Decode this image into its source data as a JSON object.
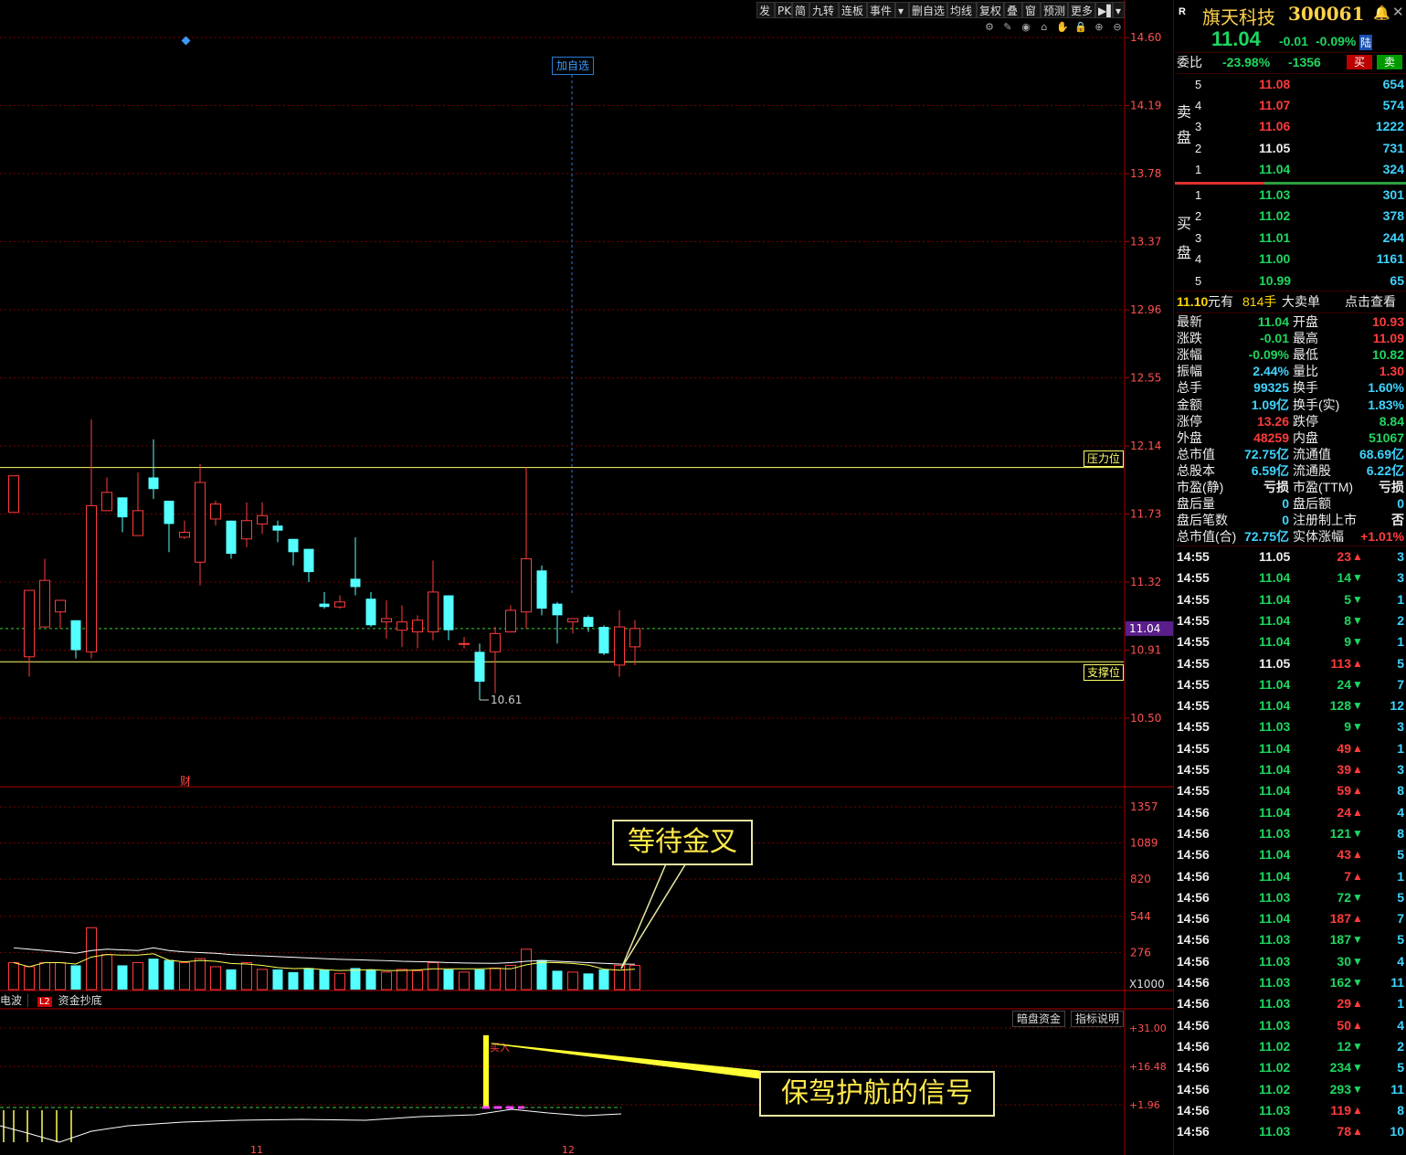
{
  "toolbar": {
    "buttons": [
      "发",
      "PK",
      "简",
      "九转",
      "连板",
      "事件",
      "▾",
      "删自选",
      "均线",
      "复权",
      "叠",
      "窗",
      "预测",
      "更多",
      "▶▌",
      "▾"
    ],
    "icons": [
      "gear-icon",
      "pen-icon",
      "eye-icon",
      "lock-open-icon",
      "hand-icon",
      "lock-icon",
      "zoom-in-icon",
      "zoom-out-icon"
    ]
  },
  "price_axis": [
    "14.60",
    "14.19",
    "13.78",
    "13.37",
    "12.96",
    "12.55",
    "12.14",
    "11.73",
    "11.32",
    "11.04",
    "10.91",
    "10.50"
  ],
  "volume_axis": [
    "1357",
    "1089",
    "820",
    "544",
    "276",
    "X1000"
  ],
  "indicator_axis": [
    "+31.00",
    "+16.48",
    "+1.96"
  ],
  "date_axis": [
    "11",
    "12"
  ],
  "labels": {
    "add_watch": "加自选",
    "resistance": "压力位",
    "support": "支撑位",
    "low_mark": "10.61",
    "finance": "财",
    "indicator_tab_left": "电波",
    "indicator_tab_l2": "L2",
    "indicator_tab_name": "资金抄底",
    "dark_fund_btn": "暗盘资金",
    "indicator_help_btn": "指标说明",
    "buy_signal": "买入"
  },
  "callouts": {
    "golden_cross": "等待金叉",
    "escort_signal": "保驾护航的信号"
  },
  "chart_data": {
    "type": "candlestick",
    "price_range": [
      10.3,
      14.7
    ],
    "resistance_level": 12.01,
    "support_level": 10.84,
    "last_price_line": 11.04,
    "low_annotation": 10.61,
    "candles": [
      {
        "o": 11.74,
        "c": 11.96,
        "h": 11.96,
        "l": 11.74
      },
      {
        "o": 10.87,
        "c": 11.27,
        "h": 11.27,
        "l": 10.75
      },
      {
        "o": 11.05,
        "c": 11.33,
        "h": 11.46,
        "l": 11.05
      },
      {
        "o": 11.14,
        "c": 11.21,
        "h": 11.21,
        "l": 11.04
      },
      {
        "o": 11.09,
        "c": 10.91,
        "h": 11.09,
        "l": 10.86
      },
      {
        "o": 10.9,
        "c": 11.78,
        "h": 12.3,
        "l": 10.86
      },
      {
        "o": 11.75,
        "c": 11.86,
        "h": 11.95,
        "l": 11.75
      },
      {
        "o": 11.83,
        "c": 11.71,
        "h": 11.83,
        "l": 11.62
      },
      {
        "o": 11.6,
        "c": 11.75,
        "h": 11.98,
        "l": 11.6
      },
      {
        "o": 11.95,
        "c": 11.88,
        "h": 12.18,
        "l": 11.82
      },
      {
        "o": 11.81,
        "c": 11.67,
        "h": 11.81,
        "l": 11.5
      },
      {
        "o": 11.59,
        "c": 11.62,
        "h": 11.69,
        "l": 11.58
      },
      {
        "o": 11.44,
        "c": 11.92,
        "h": 12.03,
        "l": 11.3
      },
      {
        "o": 11.7,
        "c": 11.79,
        "h": 11.81,
        "l": 11.66
      },
      {
        "o": 11.69,
        "c": 11.49,
        "h": 11.69,
        "l": 11.46
      },
      {
        "o": 11.58,
        "c": 11.69,
        "h": 11.8,
        "l": 11.53
      },
      {
        "o": 11.67,
        "c": 11.72,
        "h": 11.8,
        "l": 11.61
      },
      {
        "o": 11.66,
        "c": 11.63,
        "h": 11.69,
        "l": 11.56
      },
      {
        "o": 11.58,
        "c": 11.5,
        "h": 11.58,
        "l": 11.42
      },
      {
        "o": 11.52,
        "c": 11.38,
        "h": 11.52,
        "l": 11.32
      },
      {
        "o": 11.19,
        "c": 11.17,
        "h": 11.26,
        "l": 11.16
      },
      {
        "o": 11.17,
        "c": 11.2,
        "h": 11.24,
        "l": 11.16
      },
      {
        "o": 11.34,
        "c": 11.29,
        "h": 11.59,
        "l": 11.24
      },
      {
        "o": 11.22,
        "c": 11.06,
        "h": 11.26,
        "l": 11.05
      },
      {
        "o": 11.08,
        "c": 11.1,
        "h": 11.21,
        "l": 10.98
      },
      {
        "o": 11.03,
        "c": 11.08,
        "h": 11.18,
        "l": 10.93
      },
      {
        "o": 11.02,
        "c": 11.09,
        "h": 11.12,
        "l": 10.92
      },
      {
        "o": 11.02,
        "c": 11.26,
        "h": 11.45,
        "l": 10.97
      },
      {
        "o": 11.24,
        "c": 11.03,
        "h": 11.24,
        "l": 10.97
      },
      {
        "o": 10.95,
        "c": 10.95,
        "h": 10.99,
        "l": 10.92
      },
      {
        "o": 10.9,
        "c": 10.72,
        "h": 10.95,
        "l": 10.61
      },
      {
        "o": 10.9,
        "c": 11.01,
        "h": 11.05,
        "l": 10.65
      },
      {
        "o": 11.02,
        "c": 11.15,
        "h": 11.18,
        "l": 11.02
      },
      {
        "o": 11.14,
        "c": 11.46,
        "h": 12.01,
        "l": 11.04
      },
      {
        "o": 11.39,
        "c": 11.16,
        "h": 11.42,
        "l": 11.12
      },
      {
        "o": 11.19,
        "c": 11.12,
        "h": 11.2,
        "l": 10.95
      },
      {
        "o": 11.08,
        "c": 11.1,
        "h": 11.08,
        "l": 11.01
      },
      {
        "o": 11.11,
        "c": 11.05,
        "h": 11.12,
        "l": 11.02
      },
      {
        "o": 11.05,
        "c": 10.89,
        "h": 11.06,
        "l": 10.88
      },
      {
        "o": 10.82,
        "c": 11.05,
        "h": 11.15,
        "l": 10.75
      },
      {
        "o": 10.93,
        "c": 11.04,
        "h": 11.09,
        "l": 10.82
      }
    ],
    "volume_k": [
      200,
      170,
      200,
      200,
      180,
      460,
      260,
      180,
      200,
      230,
      220,
      200,
      230,
      170,
      150,
      200,
      150,
      150,
      130,
      160,
      150,
      120,
      160,
      150,
      130,
      150,
      140,
      200,
      150,
      130,
      150,
      160,
      180,
      300,
      220,
      140,
      130,
      120,
      150,
      180,
      180
    ],
    "volume_ma": [
      310,
      300,
      290,
      280,
      270,
      290,
      300,
      295,
      290,
      310,
      290,
      280,
      275,
      270,
      260,
      255,
      250,
      245,
      240,
      235,
      230,
      225,
      222,
      218,
      215,
      210,
      208,
      205,
      200,
      198,
      196,
      195,
      200,
      210,
      215,
      210,
      205,
      200,
      195,
      190,
      188
    ],
    "indicator_signal_index": 30
  },
  "quote": {
    "badge": "R",
    "name": "旗天科技",
    "code": "300061",
    "bell_icon": "bell-icon",
    "last": "11.04",
    "change": "-0.01",
    "change_pct": "-0.09%",
    "exchange_badge": "陆",
    "weibi_label": "委比",
    "weibi": "-23.98%",
    "weicha": "-1356",
    "buy_btn": "买",
    "sell_btn": "卖",
    "sell_label_1": "卖",
    "sell_label_2": "盘",
    "buy_label_1": "买",
    "buy_label_2": "盘",
    "asks": [
      {
        "lvl": "5",
        "price": "11.08",
        "vol": "654"
      },
      {
        "lvl": "4",
        "price": "11.07",
        "vol": "574"
      },
      {
        "lvl": "3",
        "price": "11.06",
        "vol": "1222"
      },
      {
        "lvl": "2",
        "price": "11.05",
        "vol": "731"
      },
      {
        "lvl": "1",
        "price": "11.04",
        "vol": "324"
      }
    ],
    "bids": [
      {
        "lvl": "1",
        "price": "11.03",
        "vol": "301"
      },
      {
        "lvl": "2",
        "price": "11.02",
        "vol": "378"
      },
      {
        "lvl": "3",
        "price": "11.01",
        "vol": "244"
      },
      {
        "lvl": "4",
        "price": "11.00",
        "vol": "1161"
      },
      {
        "lvl": "5",
        "price": "10.99",
        "vol": "65"
      }
    ],
    "big_order": {
      "price": "11.10",
      "unit": "元有",
      "qty": "814手",
      "type": "大卖单",
      "link": "点击查看"
    },
    "stats": [
      {
        "l1": "最新",
        "v1": "11.04",
        "c1": "green",
        "l2": "开盘",
        "v2": "10.93",
        "c2": "red"
      },
      {
        "l1": "涨跌",
        "v1": "-0.01",
        "c1": "green",
        "l2": "最高",
        "v2": "11.09",
        "c2": "red"
      },
      {
        "l1": "涨幅",
        "v1": "-0.09%",
        "c1": "green",
        "l2": "最低",
        "v2": "10.82",
        "c2": "green"
      },
      {
        "l1": "振幅",
        "v1": "2.44%",
        "c1": "cyan",
        "l2": "量比",
        "v2": "1.30",
        "c2": "red"
      },
      {
        "l1": "总手",
        "v1": "99325",
        "c1": "cyan",
        "l2": "换手",
        "v2": "1.60%",
        "c2": "cyan"
      },
      {
        "l1": "金额",
        "v1": "1.09亿",
        "c1": "cyan",
        "l2": "换手(实)",
        "v2": "1.83%",
        "c2": "cyan"
      },
      {
        "l1": "涨停",
        "v1": "13.26",
        "c1": "red",
        "l2": "跌停",
        "v2": "8.84",
        "c2": "green"
      },
      {
        "l1": "外盘",
        "v1": "48259",
        "c1": "red",
        "l2": "内盘",
        "v2": "51067",
        "c2": "green"
      },
      {
        "l1": "总市值",
        "v1": "72.75亿",
        "c1": "cyan",
        "l2": "流通值",
        "v2": "68.69亿",
        "c2": "cyan"
      },
      {
        "l1": "总股本",
        "v1": "6.59亿",
        "c1": "cyan",
        "l2": "流通股",
        "v2": "6.22亿",
        "c2": "cyan"
      },
      {
        "l1": "市盈(静)",
        "v1": "亏损",
        "c1": "white",
        "l2": "市盈(TTM)",
        "v2": "亏损",
        "c2": "white"
      },
      {
        "l1": "盘后量",
        "v1": "0",
        "c1": "cyan",
        "l2": "盘后额",
        "v2": "0",
        "c2": "cyan"
      },
      {
        "l1": "盘后笔数",
        "v1": "0",
        "c1": "cyan",
        "l2": "注册制上市",
        "v2": "否",
        "c2": "white"
      },
      {
        "l1": "总市值(合)",
        "v1": "72.75亿",
        "c1": "cyan",
        "l2": "实体涨幅",
        "v2": "+1.01%",
        "c2": "red"
      }
    ],
    "ticks": [
      {
        "t": "14:55",
        "p": "11.05",
        "pc": "white",
        "v": "23",
        "d": "up",
        "n": "3"
      },
      {
        "t": "14:55",
        "p": "11.04",
        "pc": "green",
        "v": "14",
        "d": "down",
        "n": "3"
      },
      {
        "t": "14:55",
        "p": "11.04",
        "pc": "green",
        "v": "5",
        "d": "down",
        "n": "1"
      },
      {
        "t": "14:55",
        "p": "11.04",
        "pc": "green",
        "v": "8",
        "d": "down",
        "n": "2"
      },
      {
        "t": "14:55",
        "p": "11.04",
        "pc": "green",
        "v": "9",
        "d": "down",
        "n": "1"
      },
      {
        "t": "14:55",
        "p": "11.05",
        "pc": "white",
        "v": "113",
        "d": "up",
        "n": "5"
      },
      {
        "t": "14:55",
        "p": "11.04",
        "pc": "green",
        "v": "24",
        "d": "down",
        "n": "7"
      },
      {
        "t": "14:55",
        "p": "11.04",
        "pc": "green",
        "v": "128",
        "d": "down",
        "n": "12"
      },
      {
        "t": "14:55",
        "p": "11.03",
        "pc": "green",
        "v": "9",
        "d": "down",
        "n": "3"
      },
      {
        "t": "14:55",
        "p": "11.04",
        "pc": "green",
        "v": "49",
        "d": "up",
        "n": "1"
      },
      {
        "t": "14:55",
        "p": "11.04",
        "pc": "green",
        "v": "39",
        "d": "up",
        "n": "3"
      },
      {
        "t": "14:55",
        "p": "11.04",
        "pc": "green",
        "v": "59",
        "d": "up",
        "n": "8"
      },
      {
        "t": "14:56",
        "p": "11.04",
        "pc": "green",
        "v": "24",
        "d": "up",
        "n": "4"
      },
      {
        "t": "14:56",
        "p": "11.03",
        "pc": "green",
        "v": "121",
        "d": "down",
        "n": "8"
      },
      {
        "t": "14:56",
        "p": "11.04",
        "pc": "green",
        "v": "43",
        "d": "up",
        "n": "5"
      },
      {
        "t": "14:56",
        "p": "11.04",
        "pc": "green",
        "v": "7",
        "d": "up",
        "n": "1"
      },
      {
        "t": "14:56",
        "p": "11.03",
        "pc": "green",
        "v": "72",
        "d": "down",
        "n": "5"
      },
      {
        "t": "14:56",
        "p": "11.04",
        "pc": "green",
        "v": "187",
        "d": "up",
        "n": "7"
      },
      {
        "t": "14:56",
        "p": "11.03",
        "pc": "green",
        "v": "187",
        "d": "down",
        "n": "5"
      },
      {
        "t": "14:56",
        "p": "11.03",
        "pc": "green",
        "v": "30",
        "d": "down",
        "n": "4"
      },
      {
        "t": "14:56",
        "p": "11.03",
        "pc": "green",
        "v": "162",
        "d": "down",
        "n": "11"
      },
      {
        "t": "14:56",
        "p": "11.03",
        "pc": "green",
        "v": "29",
        "d": "up",
        "n": "1"
      },
      {
        "t": "14:56",
        "p": "11.03",
        "pc": "green",
        "v": "50",
        "d": "up",
        "n": "4"
      },
      {
        "t": "14:56",
        "p": "11.02",
        "pc": "green",
        "v": "12",
        "d": "down",
        "n": "2"
      },
      {
        "t": "14:56",
        "p": "11.02",
        "pc": "green",
        "v": "234",
        "d": "down",
        "n": "5"
      },
      {
        "t": "14:56",
        "p": "11.02",
        "pc": "green",
        "v": "293",
        "d": "down",
        "n": "11"
      },
      {
        "t": "14:56",
        "p": "11.03",
        "pc": "green",
        "v": "119",
        "d": "up",
        "n": "8"
      },
      {
        "t": "14:56",
        "p": "11.03",
        "pc": "green",
        "v": "78",
        "d": "up",
        "n": "10"
      }
    ]
  },
  "colors": {
    "up": "#ff3b3b",
    "down": "#54ffff",
    "grid": "#7a0000",
    "axis_text": "#ff5050",
    "level_line": "#ffff6a",
    "last_line": "#3ccc3c"
  }
}
